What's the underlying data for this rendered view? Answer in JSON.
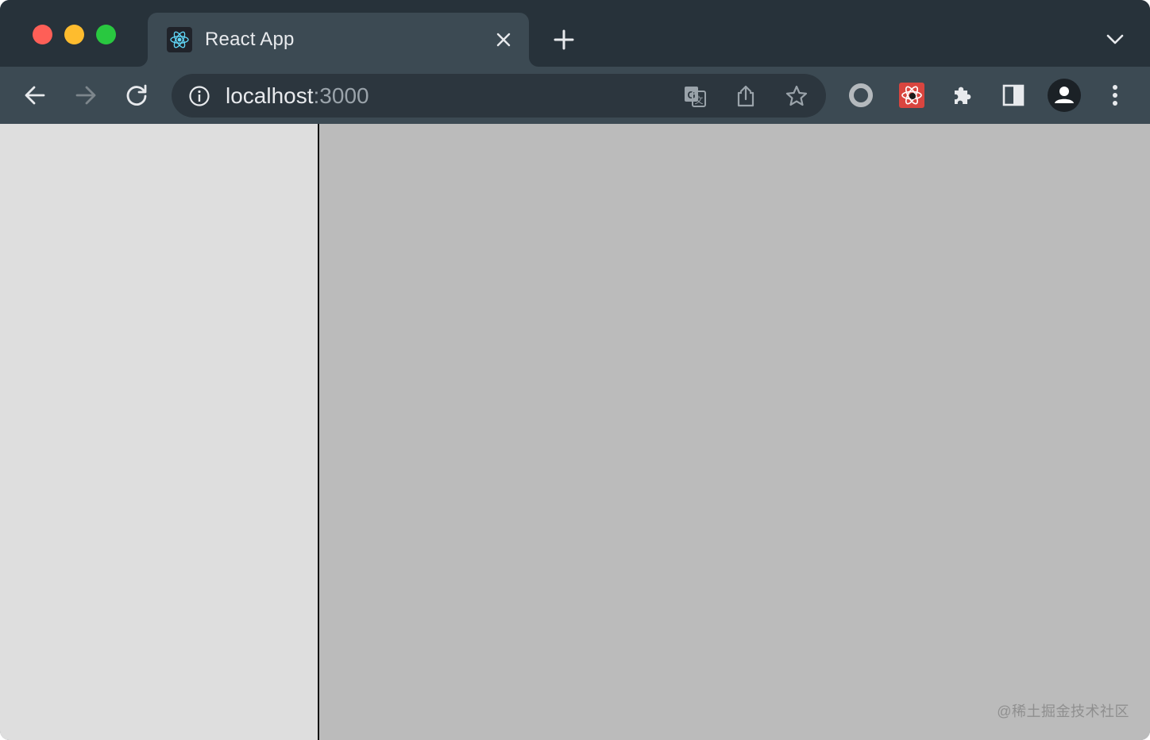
{
  "window": {
    "traffic_lights": {
      "close_color": "#fe5f57",
      "minimize_color": "#febc2e",
      "maximize_color": "#29c840"
    }
  },
  "tab": {
    "title": "React App",
    "favicon": "react-logo-icon",
    "close_icon": "close-icon"
  },
  "tabstrip": {
    "new_tab_icon": "plus-icon",
    "tab_search_icon": "chevron-down-icon"
  },
  "toolbar": {
    "back_icon": "arrow-left-icon",
    "forward_icon": "arrow-right-icon",
    "reload_icon": "reload-icon",
    "address": {
      "info_icon": "info-icon",
      "host": "localhost",
      "port": ":3000",
      "translate_icon": "translate-icon",
      "share_icon": "share-icon",
      "bookmark_icon": "star-icon"
    },
    "extensions": [
      "circle-extension-icon",
      "react-devtools-icon",
      "puzzle-icon"
    ],
    "side_panel_icon": "side-panel-icon",
    "profile_icon": "profile-icon",
    "menu_icon": "kebab-menu-icon"
  },
  "page": {
    "left_pane_color": "#dedede",
    "right_pane_color": "#bbbbbb",
    "divider_color": "#111111",
    "watermark": "@稀土掘金技术社区"
  },
  "colors": {
    "tabstrip_bg": "#27323a",
    "toolbar_bg": "#3c4a53",
    "omnibox_bg": "#2c363e",
    "text": "#e8eaed"
  }
}
